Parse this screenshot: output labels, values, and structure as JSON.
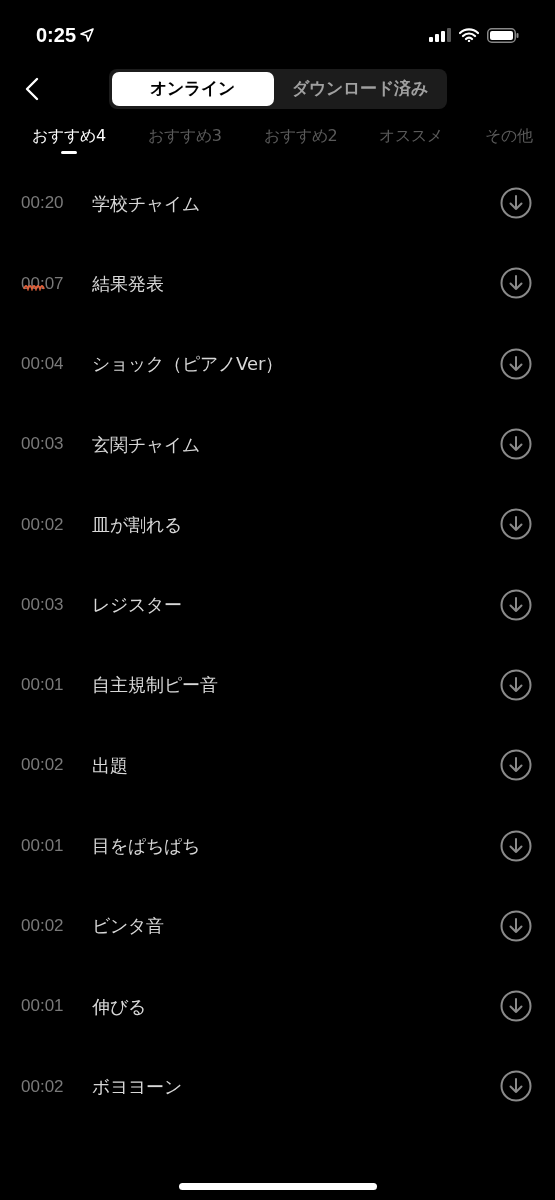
{
  "status_bar": {
    "time": "0:25"
  },
  "segments": [
    {
      "label": "オンライン",
      "selected": true
    },
    {
      "label": "ダウンロード済み",
      "selected": false
    }
  ],
  "categories": [
    {
      "label": "おすすめ4",
      "selected": true
    },
    {
      "label": "おすすめ3",
      "selected": false
    },
    {
      "label": "おすすめ2",
      "selected": false
    },
    {
      "label": "オススメ",
      "selected": false
    },
    {
      "label": "その他",
      "selected": false
    }
  ],
  "sounds": [
    {
      "duration": "00:20",
      "title": "学校チャイム",
      "playing": false
    },
    {
      "duration": "00:07",
      "title": "結果発表",
      "playing": true
    },
    {
      "duration": "00:04",
      "title": "ショック（ピアノVer）",
      "playing": false
    },
    {
      "duration": "00:03",
      "title": "玄関チャイム",
      "playing": false
    },
    {
      "duration": "00:02",
      "title": "皿が割れる",
      "playing": false
    },
    {
      "duration": "00:03",
      "title": "レジスター",
      "playing": false
    },
    {
      "duration": "00:01",
      "title": "自主規制ピー音",
      "playing": false
    },
    {
      "duration": "00:02",
      "title": "出題",
      "playing": false
    },
    {
      "duration": "00:01",
      "title": "目をぱちぱち",
      "playing": false
    },
    {
      "duration": "00:02",
      "title": "ビンタ音",
      "playing": false
    },
    {
      "duration": "00:01",
      "title": "伸びる",
      "playing": false
    },
    {
      "duration": "00:02",
      "title": "ボヨヨーン",
      "playing": false
    }
  ]
}
